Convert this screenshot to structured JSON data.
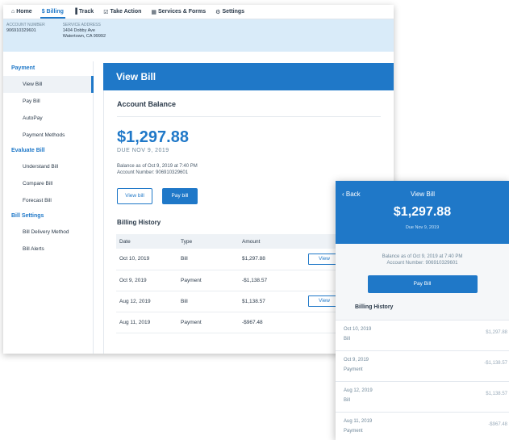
{
  "nav": {
    "home": "Home",
    "billing": "$ Billing",
    "track": "Track",
    "take_action": "Take Action",
    "services": "Services & Forms",
    "settings": "Settings"
  },
  "account": {
    "number_label": "ACCOUNT NUMBER",
    "number": "906910329601",
    "address_label": "SERVICE ADDRESS",
    "address_line1": "1404 Dobby Ave",
    "address_line2": "Watertown, CA 99992"
  },
  "sidebar": {
    "payment_heading": "Payment",
    "payment_items": [
      "View Bill",
      "Pay Bill",
      "AutoPay",
      "Payment Methods"
    ],
    "evaluate_heading": "Evaluate Bill",
    "evaluate_items": [
      "Understand Bill",
      "Compare Bill",
      "Forecast Bill"
    ],
    "settings_heading": "Bill Settings",
    "settings_items": [
      "Bill Delivery Method",
      "Bill Alerts"
    ]
  },
  "main": {
    "title": "View Bill",
    "balance_heading": "Account Balance",
    "amount": "$1,297.88",
    "due": "DUE NOV 9, 2019",
    "balance_as_of": "Balance as of Oct 9, 2019 at 7:40 PM",
    "account_number_line": "Account Number: 906910329601",
    "view_bill_btn": "View bill",
    "pay_bill_btn": "Pay bill",
    "history_heading": "Billing History",
    "columns": [
      "Date",
      "Type",
      "Amount"
    ],
    "rows": [
      {
        "date": "Oct 10, 2019",
        "type": "Bill",
        "amount": "$1,297.88",
        "action": "View"
      },
      {
        "date": "Oct 9, 2019",
        "type": "Payment",
        "amount": "-$1,138.57",
        "action": ""
      },
      {
        "date": "Aug 12, 2019",
        "type": "Bill",
        "amount": "$1,138.57",
        "action": "View"
      },
      {
        "date": "Aug 11, 2019",
        "type": "Payment",
        "amount": "-$967.48",
        "action": ""
      }
    ]
  },
  "mobile": {
    "back": "‹ Back",
    "title": "View Bill",
    "amount": "$1,297.88",
    "due": "Due Nov 9, 2019",
    "balance_as_of": "Balance as of Oct 9, 2019 at 7:40 PM",
    "account_number_line": "Account Number: 906910329601",
    "pay_btn": "Pay Bill",
    "history_heading": "Billing History",
    "rows": [
      {
        "date": "Oct 10, 2019",
        "type": "Bill",
        "amount": "$1,297.88"
      },
      {
        "date": "Oct 9, 2019",
        "type": "Payment",
        "amount": "-$1,138.57"
      },
      {
        "date": "Aug 12, 2019",
        "type": "Bill",
        "amount": "$1,138.57"
      },
      {
        "date": "Aug 11, 2019",
        "type": "Payment",
        "amount": "-$967.48"
      }
    ]
  },
  "colors": {
    "primary": "#1f78c8",
    "account_bar": "#d9ebf9"
  }
}
